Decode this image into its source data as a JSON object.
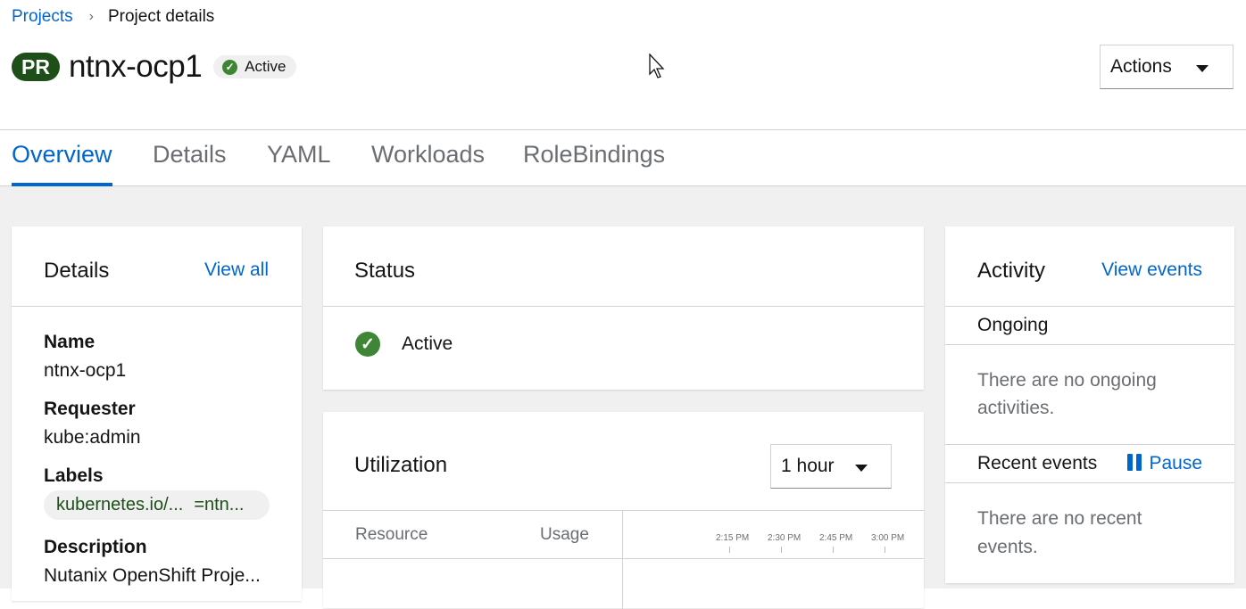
{
  "breadcrumb": {
    "parent": "Projects",
    "current": "Project details"
  },
  "header": {
    "badge": "PR",
    "project_name": "ntnx-ocp1",
    "status": "Active",
    "actions_label": "Actions"
  },
  "tabs": [
    "Overview",
    "Details",
    "YAML",
    "Workloads",
    "RoleBindings"
  ],
  "active_tab": "Overview",
  "details_card": {
    "title": "Details",
    "view_all": "View all",
    "name_label": "Name",
    "name_value": "ntnx-ocp1",
    "requester_label": "Requester",
    "requester_value": "kube:admin",
    "labels_label": "Labels",
    "label_key": "kubernetes.io/...",
    "label_value": "=ntn...",
    "description_label": "Description",
    "description_value": "Nutanix OpenShift Proje..."
  },
  "status_card": {
    "title": "Status",
    "value": "Active"
  },
  "utilization_card": {
    "title": "Utilization",
    "range": "1 hour",
    "col_resource": "Resource",
    "col_usage": "Usage",
    "time_ticks": [
      "2:15 PM",
      "2:30 PM",
      "2:45 PM",
      "3:00 PM"
    ]
  },
  "activity_card": {
    "title": "Activity",
    "view_events": "View events",
    "ongoing_label": "Ongoing",
    "ongoing_empty": "There are no ongoing activities.",
    "recent_label": "Recent events",
    "pause_label": "Pause",
    "recent_empty": "There are no recent events."
  },
  "colors": {
    "accent": "#0066cc",
    "badge": "#1e4f18",
    "success": "#3e8635"
  }
}
